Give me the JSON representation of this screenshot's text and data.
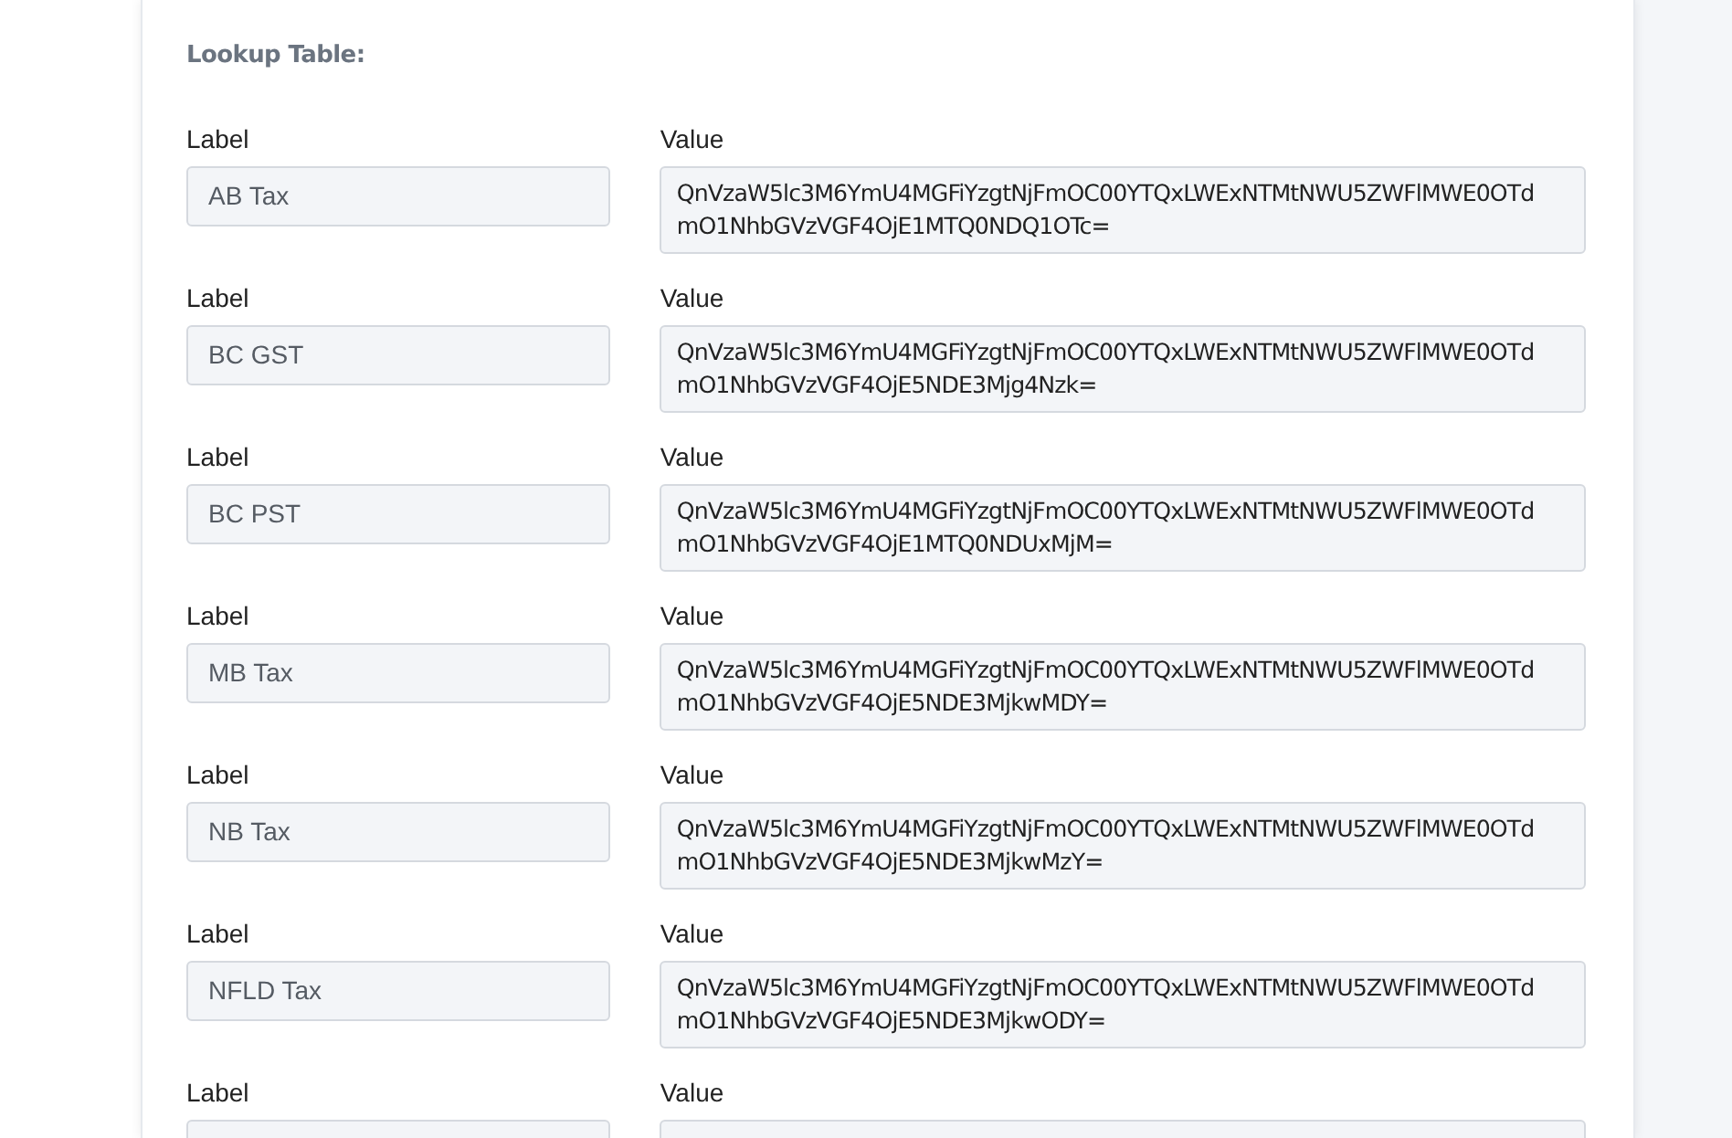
{
  "section_title": "Lookup Table:",
  "rows": [
    {
      "label_heading": "Label",
      "label": "AB Tax",
      "value_heading": "Value",
      "value": "QnVzaW5lc3M6YmU4MGFiYzgtNjFmOC00YTQxLWExNTMtNWU5ZWFlMWE0OTdmO1NhbGVzVGF4OjE1MTQ0NDQ1OTc="
    },
    {
      "label_heading": "Label",
      "label": "BC GST",
      "value_heading": "Value",
      "value": "QnVzaW5lc3M6YmU4MGFiYzgtNjFmOC00YTQxLWExNTMtNWU5ZWFlMWE0OTdmO1NhbGVzVGF4OjE5NDE3Mjg4Nzk="
    },
    {
      "label_heading": "Label",
      "label": "BC PST",
      "value_heading": "Value",
      "value": "QnVzaW5lc3M6YmU4MGFiYzgtNjFmOC00YTQxLWExNTMtNWU5ZWFlMWE0OTdmO1NhbGVzVGF4OjE1MTQ0NDUxMjM="
    },
    {
      "label_heading": "Label",
      "label": "MB Tax",
      "value_heading": "Value",
      "value": "QnVzaW5lc3M6YmU4MGFiYzgtNjFmOC00YTQxLWExNTMtNWU5ZWFlMWE0OTdmO1NhbGVzVGF4OjE5NDE3MjkwMDY="
    },
    {
      "label_heading": "Label",
      "label": "NB Tax",
      "value_heading": "Value",
      "value": "QnVzaW5lc3M6YmU4MGFiYzgtNjFmOC00YTQxLWExNTMtNWU5ZWFlMWE0OTdmO1NhbGVzVGF4OjE5NDE3MjkwMzY="
    },
    {
      "label_heading": "Label",
      "label": "NFLD Tax",
      "value_heading": "Value",
      "value": "QnVzaW5lc3M6YmU4MGFiYzgtNjFmOC00YTQxLWExNTMtNWU5ZWFlMWE0OTdmO1NhbGVzVGF4OjE5NDE3MjkwODY="
    },
    {
      "label_heading": "Label",
      "value_heading": "Value"
    }
  ]
}
